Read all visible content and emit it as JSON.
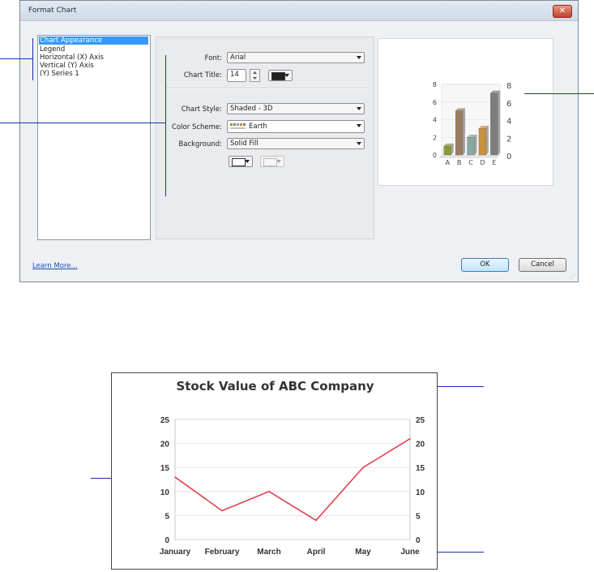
{
  "dialog": {
    "title": "Format Chart",
    "close_glyph": "✕",
    "nav_items": [
      "Chart Appearance",
      "Legend",
      "Horizontal (X) Axis",
      "Vertical (Y) Axis",
      "(Y) Series 1"
    ],
    "font_label": "Font:",
    "font_value": "Arial",
    "chart_title_label": "Chart Title:",
    "chart_title_size": "14",
    "chart_style_label": "Chart Style:",
    "chart_style_value": "Shaded - 3D",
    "color_scheme_label": "Color Scheme:",
    "color_scheme_value": "Earth",
    "background_label": "Background:",
    "background_value": "Solid Fill",
    "learn_more": "Learn More...",
    "ok_label": "OK",
    "cancel_label": "Cancel",
    "title_color": "#222222",
    "accent": "#3399ff"
  },
  "chart_data": [
    {
      "type": "bar",
      "categories": [
        "A",
        "B",
        "C",
        "D",
        "E"
      ],
      "values": [
        1,
        5,
        2,
        3,
        7
      ],
      "ylim": [
        0,
        8
      ],
      "yticks": [
        0,
        2,
        4,
        6,
        8
      ],
      "title": "",
      "xlabel": "",
      "ylabel": "",
      "colors": [
        "#8a9a3a",
        "#9b7d63",
        "#8aa7a8",
        "#c7913e",
        "#7d7d7d"
      ],
      "style": "3d"
    },
    {
      "type": "line",
      "title": "Stock Value of ABC Company",
      "categories": [
        "January",
        "February",
        "March",
        "April",
        "May",
        "June"
      ],
      "values": [
        13,
        6,
        10,
        4,
        15,
        21
      ],
      "ylim": [
        0,
        25
      ],
      "yticks": [
        0,
        5,
        10,
        15,
        20,
        25
      ],
      "xlabel": "",
      "ylabel": "",
      "grid": true,
      "line_color": "#e04050"
    }
  ]
}
